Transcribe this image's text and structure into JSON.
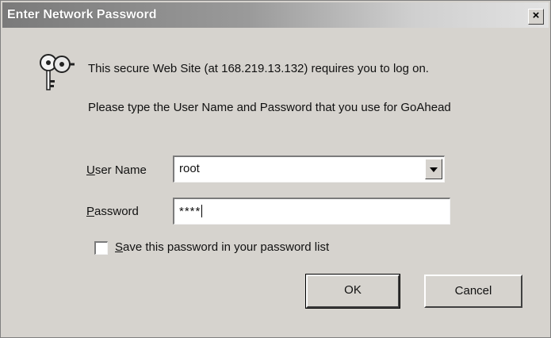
{
  "window": {
    "title": "Enter Network Password",
    "close_glyph": "×"
  },
  "icons": {
    "key": "keys-icon",
    "close": "close-icon",
    "dropdown": "chevron-down-icon"
  },
  "message": {
    "secure_site": "This secure Web Site (at 168.219.13.132) requires you to log on.",
    "instruction": "Please type the User Name and Password that you use for GoAhead"
  },
  "form": {
    "user_name": {
      "label_first": "U",
      "label_rest": "ser Name",
      "value": "root"
    },
    "password": {
      "label_first": "P",
      "label_rest": "assword",
      "value": "****"
    },
    "save_password": {
      "label_first": "S",
      "label_rest": "ave this password in your password list",
      "checked": false
    }
  },
  "buttons": {
    "ok": "OK",
    "cancel": "Cancel"
  },
  "colors": {
    "face": "#d6d3ce",
    "titlebar_text": "#ffffff"
  }
}
